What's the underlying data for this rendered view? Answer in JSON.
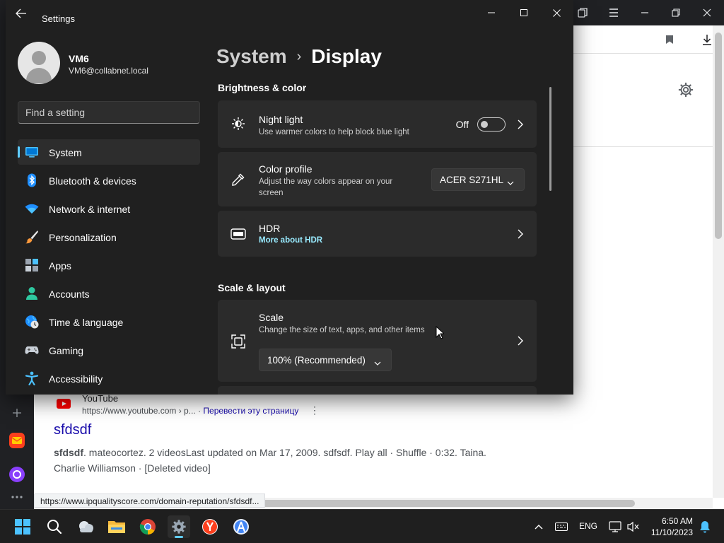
{
  "settings": {
    "window_title": "Settings",
    "user": {
      "name": "VM6",
      "email": "VM6@collabnet.local"
    },
    "search_placeholder": "Find a setting",
    "nav": [
      {
        "label": "System",
        "icon": "system-icon",
        "selected": true
      },
      {
        "label": "Bluetooth & devices",
        "icon": "bluetooth-icon"
      },
      {
        "label": "Network & internet",
        "icon": "wifi-icon"
      },
      {
        "label": "Personalization",
        "icon": "brush-icon"
      },
      {
        "label": "Apps",
        "icon": "apps-icon"
      },
      {
        "label": "Accounts",
        "icon": "accounts-icon"
      },
      {
        "label": "Time & language",
        "icon": "globe-clock-icon"
      },
      {
        "label": "Gaming",
        "icon": "gamepad-icon"
      },
      {
        "label": "Accessibility",
        "icon": "accessibility-icon"
      }
    ],
    "breadcrumb": {
      "parent": "System",
      "current": "Display"
    },
    "brightness_section": "Brightness & color",
    "night_light": {
      "title": "Night light",
      "desc": "Use warmer colors to help block blue light",
      "state": "Off"
    },
    "color_profile": {
      "title": "Color profile",
      "desc": "Adjust the way colors appear on your screen",
      "value": "ACER S271HL"
    },
    "hdr": {
      "title": "HDR",
      "link": "More about HDR"
    },
    "scale_section": "Scale & layout",
    "scale": {
      "title": "Scale",
      "desc": "Change the size of text, apps, and other items",
      "value": "100% (Recommended)"
    },
    "accent_color": "#60cdff"
  },
  "browser": {
    "result": {
      "site": "YouTube",
      "url": "https://www.youtube.com › p...",
      "translate": "Перевести эту страницу",
      "title": "sfdsdf",
      "snippet_bold": "sfdsdf",
      "snippet": ". mateocortez. 2 videosLast updated on Mar 17, 2009. sdfsdf. Play all · Shuffle · 0:32. Taina. Charlie Williamson · [Deleted video]"
    },
    "status_url": "https://www.ipqualityscore.com/domain-reputation/sfdsdf..."
  },
  "taskbar": {
    "language": "ENG",
    "time": "6:50 AM",
    "date": "11/10/2023",
    "apps": [
      "start-icon",
      "search-icon",
      "weather-icon",
      "file-explorer-icon",
      "chrome-icon",
      "settings-gear-icon",
      "yandex-icon",
      "android-studio-icon"
    ]
  }
}
